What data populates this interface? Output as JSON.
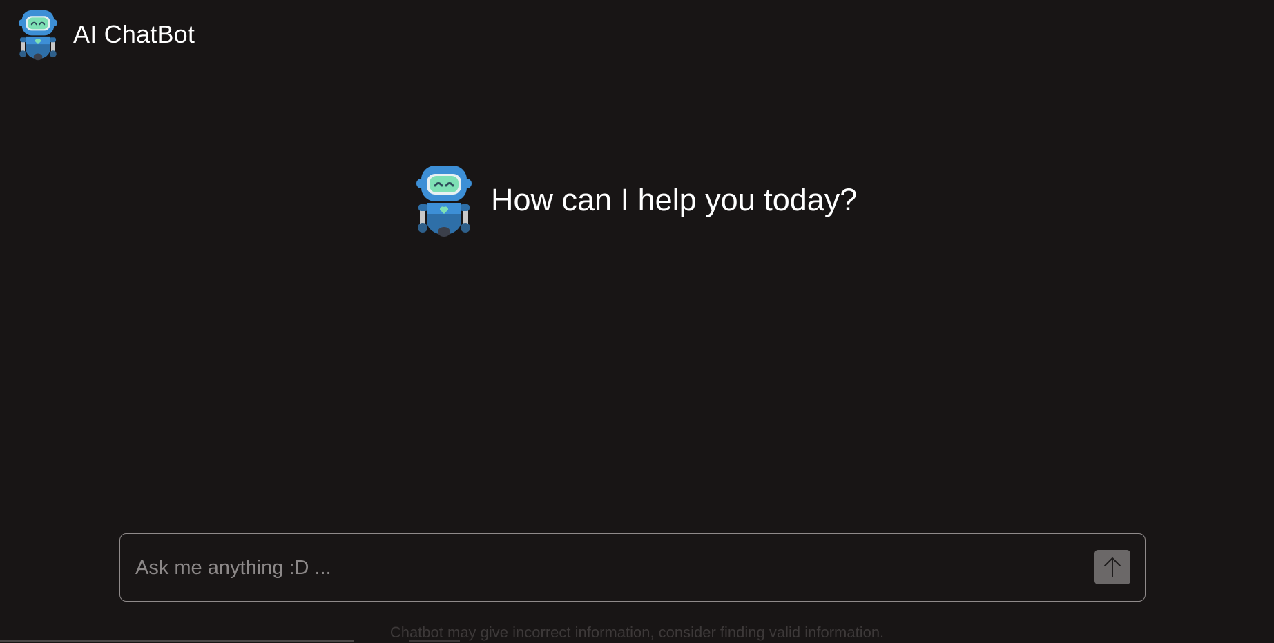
{
  "header": {
    "title": "AI ChatBot",
    "logo_icon": "robot-icon"
  },
  "main": {
    "greeting": "How can I help you today?",
    "greeting_icon": "robot-icon"
  },
  "composer": {
    "placeholder": "Ask me anything :D ...",
    "value": "",
    "send_icon": "arrow-up-icon"
  },
  "footer": {
    "disclaimer": "Chatbot may give incorrect information, consider finding valid information."
  },
  "colors": {
    "background": "#181515",
    "robot_blue": "#3d8fd6",
    "robot_dark_blue": "#2e6fa8",
    "visor": "#7ee0b5",
    "send_button": "#6b6868"
  }
}
